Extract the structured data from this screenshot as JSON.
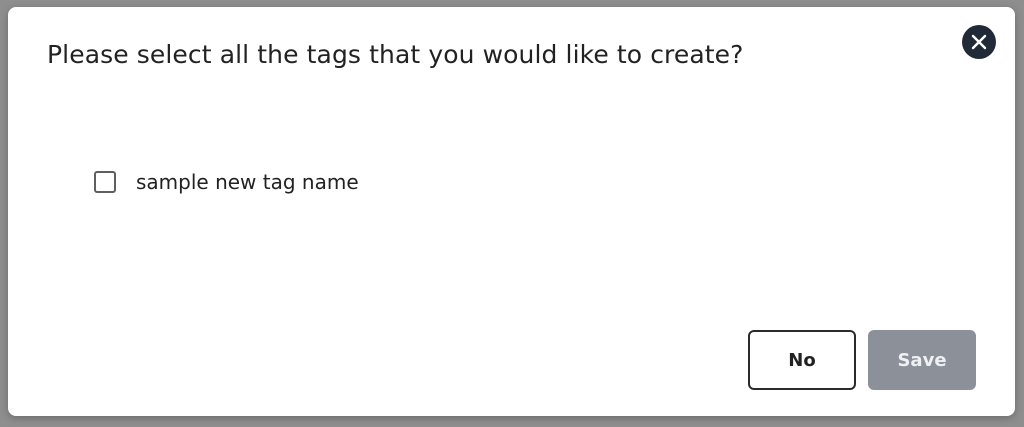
{
  "dialog": {
    "title": "Please select all the tags that you would like to create?",
    "close_icon": "close-icon",
    "options": [
      {
        "label": "sample new tag name",
        "checked": false
      }
    ],
    "buttons": {
      "no_label": "No",
      "save_label": "Save",
      "save_disabled": true
    }
  },
  "colors": {
    "backdrop": "#8e8e8e",
    "close_button_bg": "#212a37",
    "save_button_bg": "#8c9099",
    "text": "#222222"
  }
}
